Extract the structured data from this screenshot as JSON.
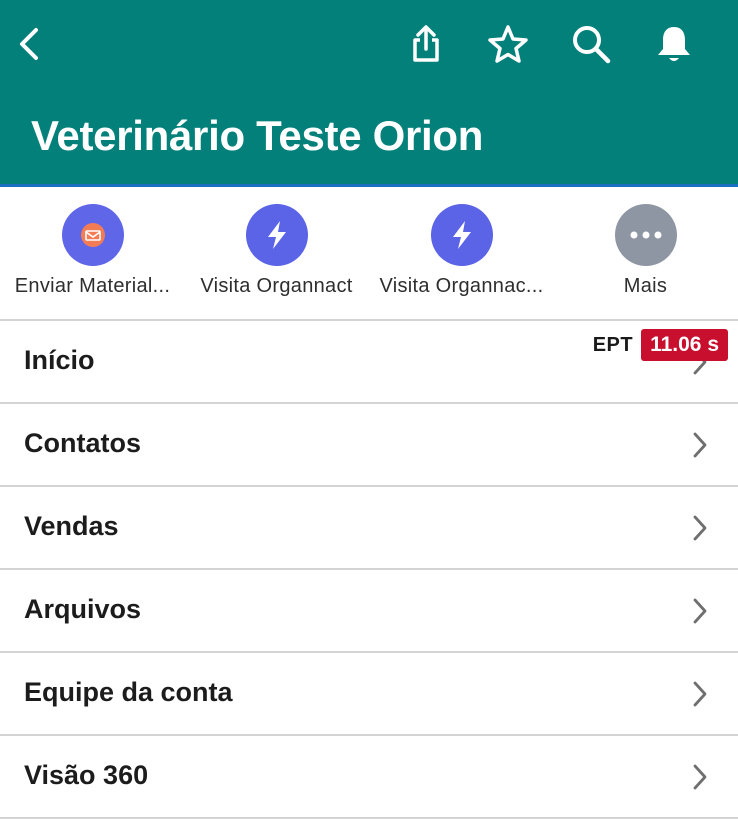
{
  "header": {
    "title": "Veterinário Teste Orion",
    "background": "#04807a",
    "icons": [
      "back-icon",
      "share-icon",
      "star-icon",
      "search-icon",
      "bell-icon"
    ]
  },
  "actions": [
    {
      "label": "Enviar Material...",
      "icon": "mail-icon",
      "color": "#6066e8",
      "inner_color": "#f47c55"
    },
    {
      "label": "Visita Organnact",
      "icon": "lightning-icon",
      "color": "#5b63e6"
    },
    {
      "label": "Visita Organnac...",
      "icon": "lightning-icon",
      "color": "#5b63e6"
    },
    {
      "label": "Mais",
      "icon": "more-icon",
      "color": "#8e96a3"
    }
  ],
  "ept": {
    "label": "EPT",
    "value": "11.06 s",
    "color": "#c8102e"
  },
  "menu": [
    {
      "label": "Início"
    },
    {
      "label": "Contatos"
    },
    {
      "label": "Vendas"
    },
    {
      "label": "Arquivos"
    },
    {
      "label": "Equipe da conta"
    },
    {
      "label": "Visão 360"
    }
  ]
}
